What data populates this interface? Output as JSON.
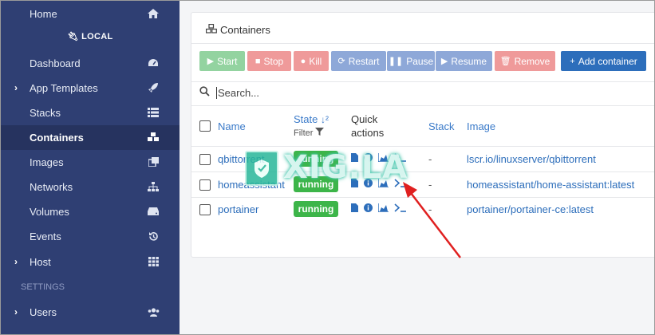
{
  "sidebar": {
    "top_item": {
      "label": "Home",
      "icon": "home-icon"
    },
    "endpoint": {
      "label": "LOCAL",
      "icon": "plug-icon"
    },
    "items": [
      {
        "label": "Dashboard",
        "icon": "tachometer-icon",
        "has_caret": false
      },
      {
        "label": "App Templates",
        "icon": "rocket-icon",
        "has_caret": true
      },
      {
        "label": "Stacks",
        "icon": "list-icon",
        "has_caret": false
      },
      {
        "label": "Containers",
        "icon": "cubes-icon",
        "has_caret": false,
        "active": true
      },
      {
        "label": "Images",
        "icon": "clone-icon",
        "has_caret": false
      },
      {
        "label": "Networks",
        "icon": "sitemap-icon",
        "has_caret": false
      },
      {
        "label": "Volumes",
        "icon": "hdd-icon",
        "has_caret": false
      },
      {
        "label": "Events",
        "icon": "history-icon",
        "has_caret": false
      },
      {
        "label": "Host",
        "icon": "th-icon",
        "has_caret": true
      }
    ],
    "settings_header": "SETTINGS",
    "users": {
      "label": "Users",
      "icon": "users-icon"
    }
  },
  "panel": {
    "title": "Containers",
    "title_icon": "cubes-icon",
    "buttons": {
      "start": "Start",
      "stop": "Stop",
      "kill": "Kill",
      "restart": "Restart",
      "pause": "Pause",
      "resume": "Resume",
      "remove": "Remove",
      "add": "Add container"
    },
    "search_placeholder": "Search..."
  },
  "table": {
    "headers": {
      "name": "Name",
      "state": "State",
      "filter": "Filter",
      "quick_actions_1": "Quick",
      "quick_actions_2": "actions",
      "stack": "Stack",
      "image": "Image"
    },
    "rows": [
      {
        "name": "qbittorrent",
        "state": "running",
        "stack": "-",
        "image": "lscr.io/linuxserver/qbittorrent"
      },
      {
        "name": "homeassistant",
        "state": "running",
        "stack": "-",
        "image": "homeassistant/home-assistant:latest"
      },
      {
        "name": "portainer",
        "state": "running",
        "stack": "-",
        "image": "portainer/portainer-ce:latest"
      }
    ]
  },
  "watermark": {
    "text": "XIG.LA"
  },
  "colors": {
    "sidebar_bg": "#2f3f73",
    "running": "#3db549",
    "link": "#2d6ebb",
    "danger": "#ef9a9a",
    "success": "#93d3a0",
    "primary": "#2d6ebb",
    "annotation_arrow": "#e02020"
  }
}
